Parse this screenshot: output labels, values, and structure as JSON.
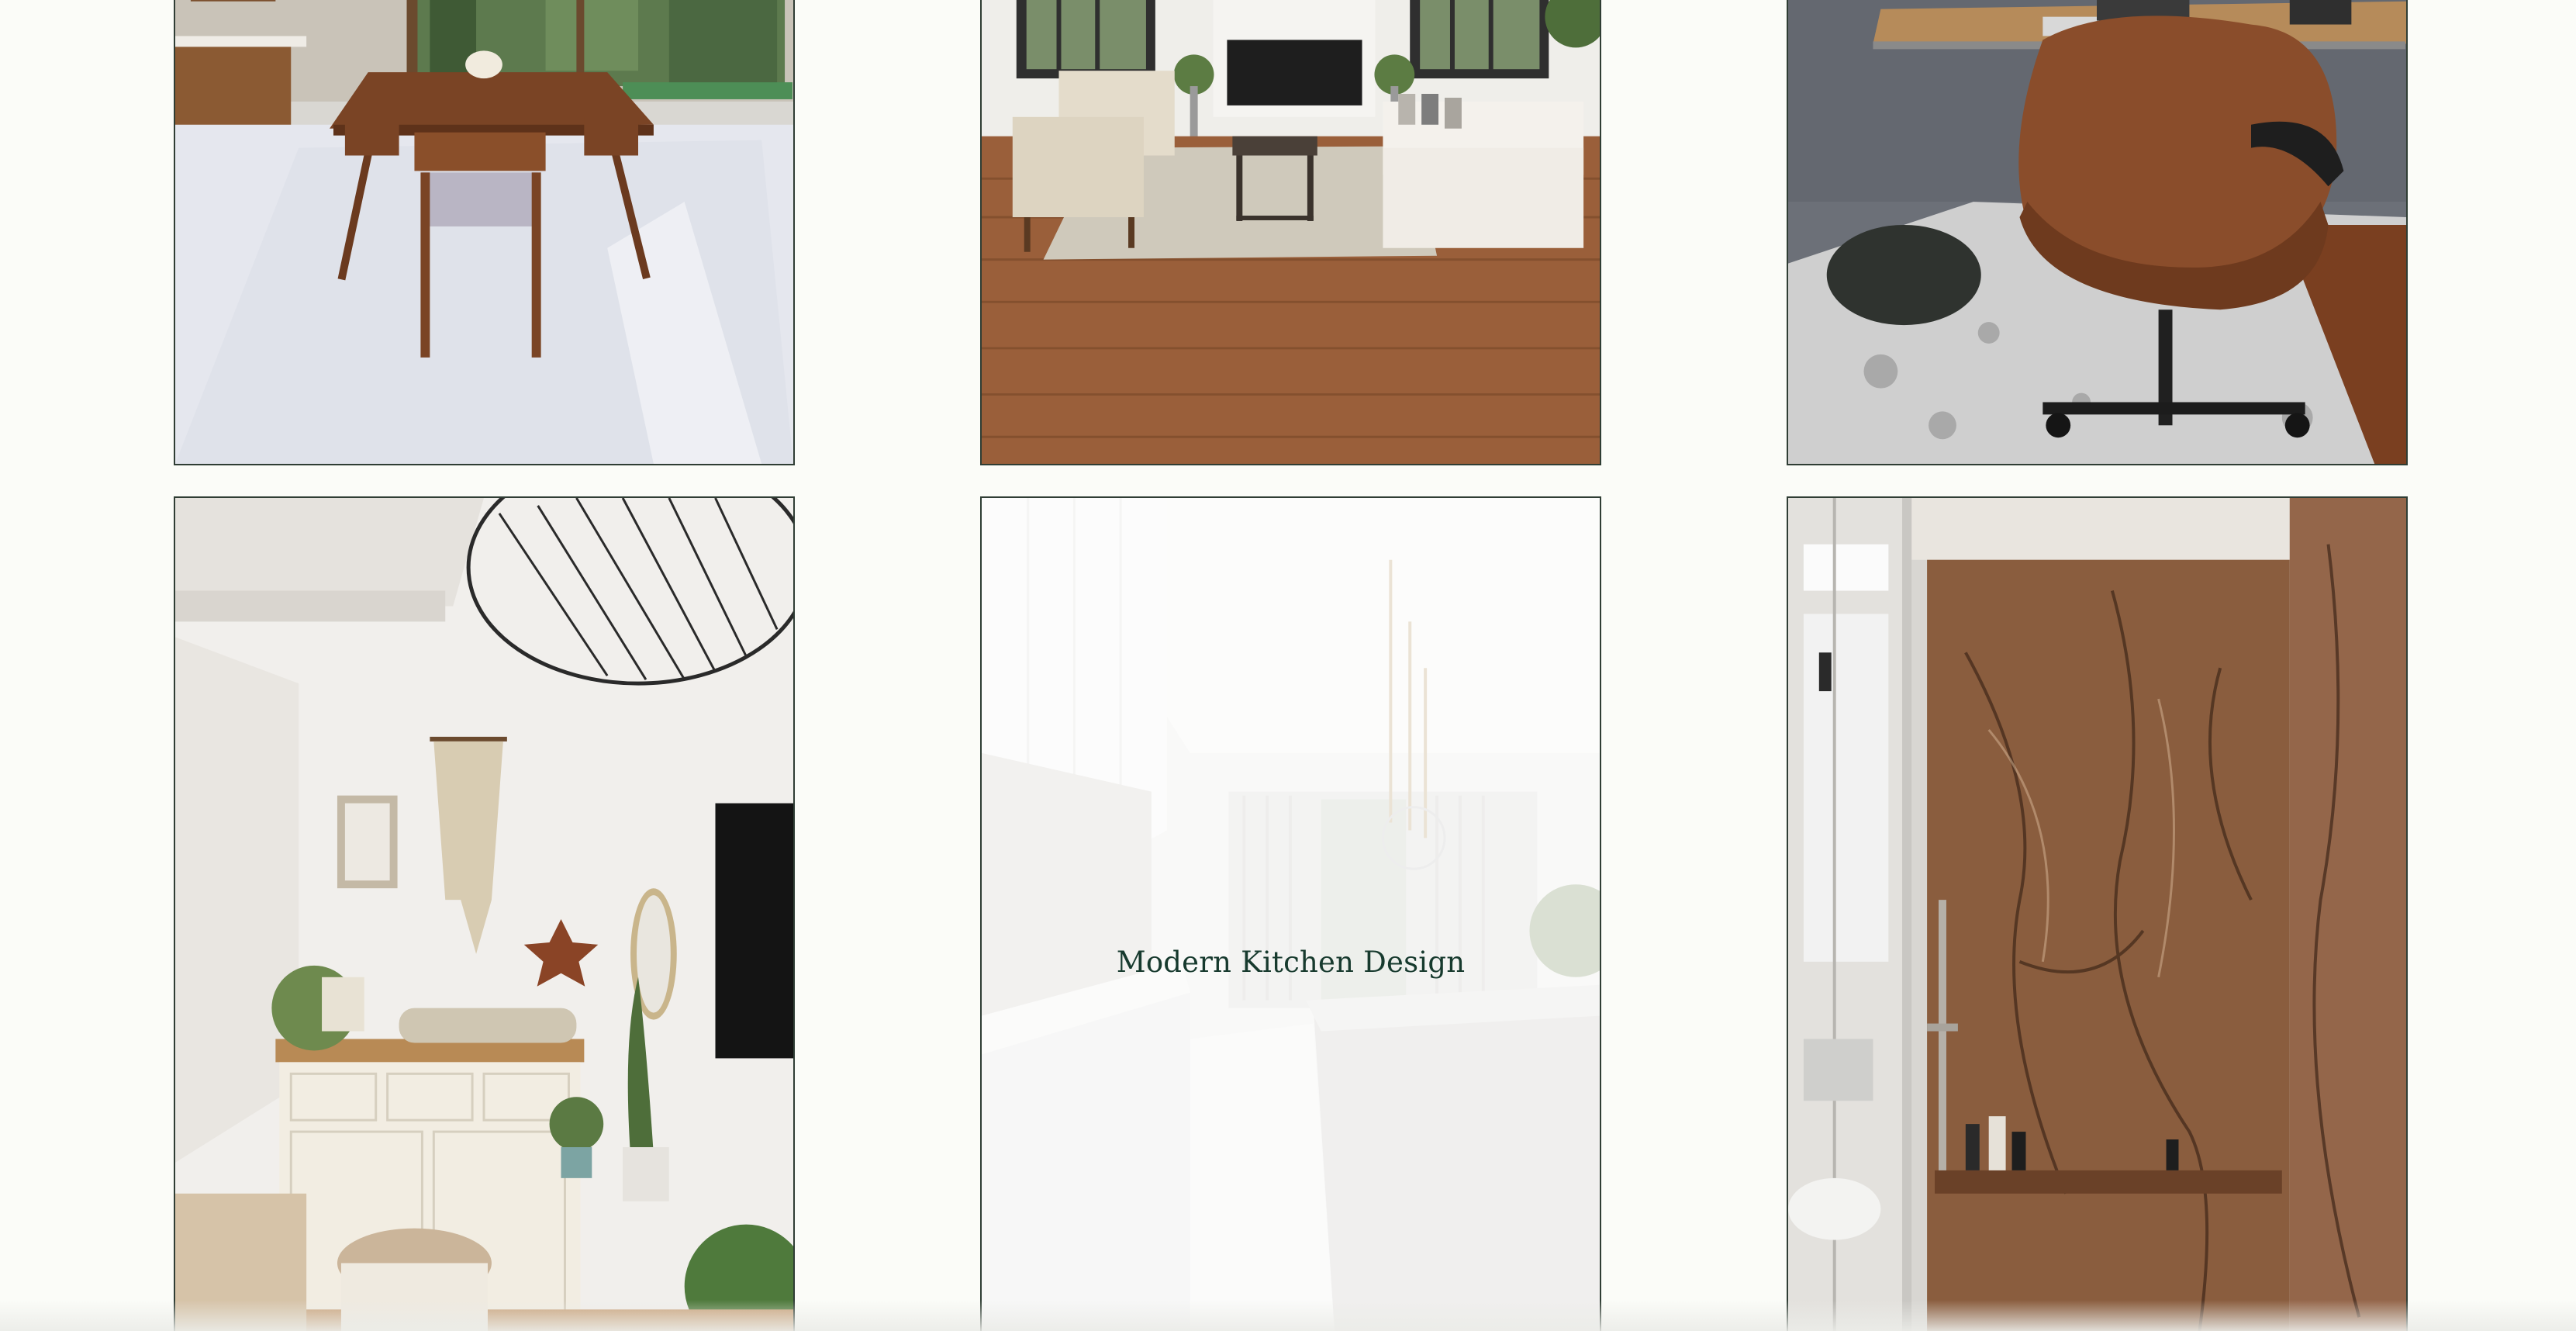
{
  "gallery": {
    "items": [
      {
        "subject": "dining room with wooden table and chairs"
      },
      {
        "subject": "living room with fireplace, sofa and armchairs"
      },
      {
        "subject": "home office with leather desk chair"
      },
      {
        "subject": "bohemian nursery with dresser and macrame"
      },
      {
        "subject": "modern white kitchen with marble island",
        "caption": "Modern Kitchen Design"
      },
      {
        "subject": "bathroom with brown marble shower wall"
      }
    ]
  },
  "colors": {
    "background": "#fbfcf8",
    "tile_border": "#2f3d34",
    "caption_text": "#173a2e"
  }
}
